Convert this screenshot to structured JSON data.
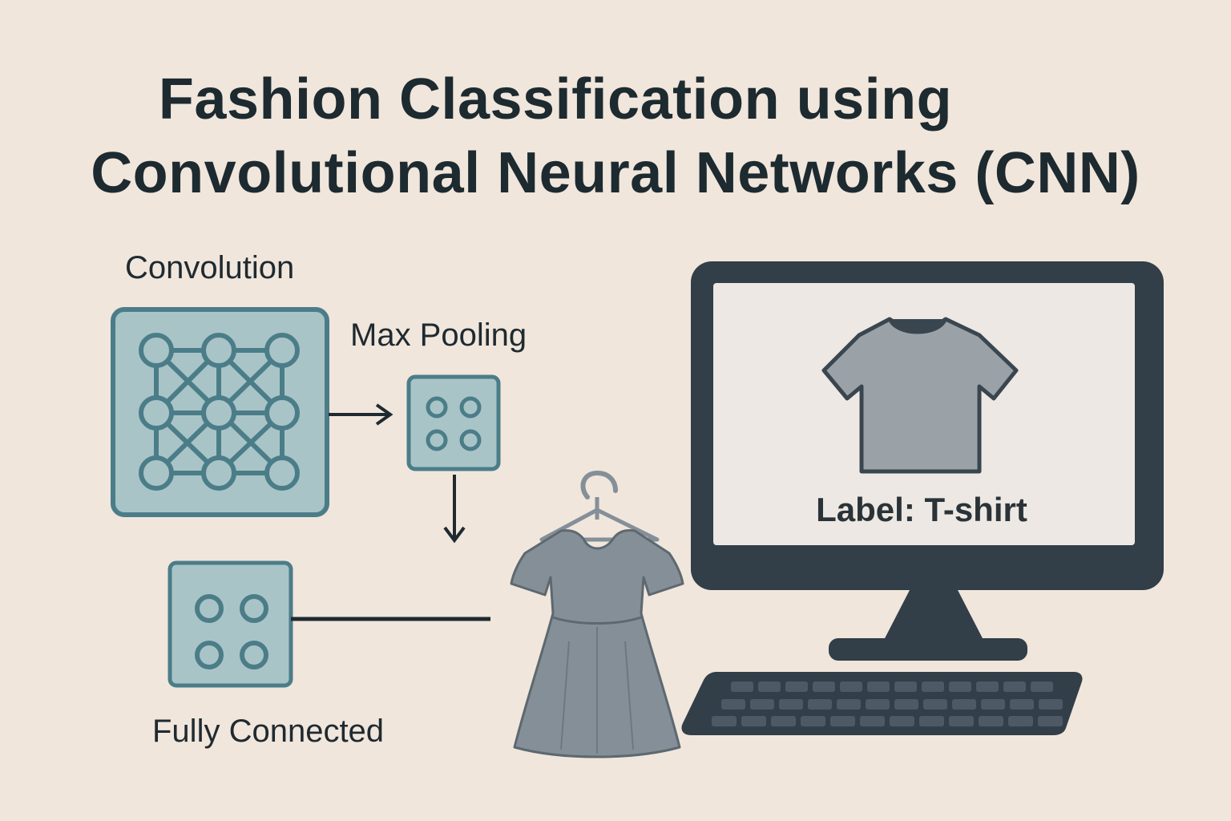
{
  "title": {
    "line1": "Fashion Classification using",
    "line2": "Convolutional Neural Networks (CNN)"
  },
  "stages": {
    "convolution": "Convolution",
    "max_pooling": "Max Pooling",
    "fully_connected": "Fully Connected"
  },
  "monitor": {
    "label": "Label: T-shirt"
  },
  "colors": {
    "background": "#f0e6dc",
    "node_box_fill": "#a9c4c7",
    "node_stroke": "#4b7d89",
    "monitor_dark": "#323e48",
    "garment_gray": "#858f98"
  }
}
